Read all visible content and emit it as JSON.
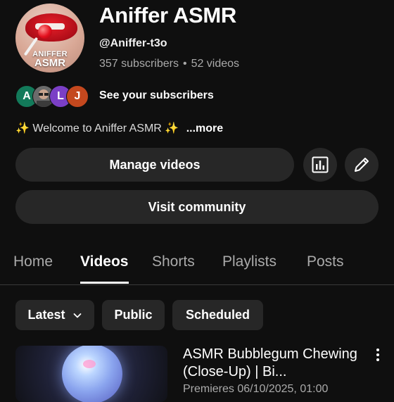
{
  "channel": {
    "logo_text_line1": "ANIFFER",
    "logo_text_line2": "ASMR",
    "name": "Aniffer ASMR",
    "handle": "@Aniffer-t3o",
    "subscribers": "357 subscribers",
    "separator": "•",
    "videos_count": "52 videos",
    "see_subscribers_label": "See your subscribers",
    "subscriber_avatars": [
      {
        "letter": "A",
        "color": "#137a5a"
      },
      {
        "letter": "",
        "color": "#6b6b6b"
      },
      {
        "letter": "L",
        "color": "#7b3fc6"
      },
      {
        "letter": "J",
        "color": "#c4481e"
      }
    ],
    "description_sparkle": "✨",
    "description": "Welcome to Aniffer ASMR",
    "more_label": "...more"
  },
  "actions": {
    "manage_videos_label": "Manage videos",
    "analytics_icon": "analytics-icon",
    "edit_icon": "pencil-icon",
    "visit_community_label": "Visit community"
  },
  "tabs": [
    {
      "label": "Home",
      "active": false
    },
    {
      "label": "Videos",
      "active": true
    },
    {
      "label": "Shorts",
      "active": false
    },
    {
      "label": "Playlists",
      "active": false
    },
    {
      "label": "Posts",
      "active": false
    }
  ],
  "filters": {
    "sort_label": "Latest",
    "public_label": "Public",
    "scheduled_label": "Scheduled"
  },
  "videos": [
    {
      "title": "ASMR Bubblegum Chewing (Close-Up) | Bi...",
      "meta": "Premieres 06/10/2025, 01:00"
    }
  ],
  "colors": {
    "background": "#0f0f0f",
    "button_bg": "#272727",
    "secondary_text": "#aaaaaa"
  }
}
